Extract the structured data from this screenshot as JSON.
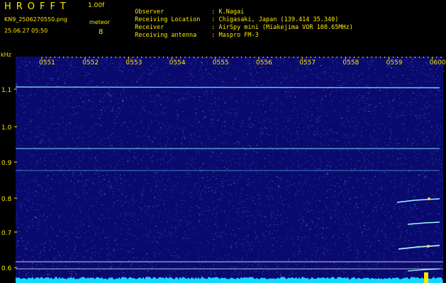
{
  "header": {
    "brand": "HROFFT",
    "version": "1.00f",
    "filename": "KN9_2506270550.png",
    "meteor_label": "meteor",
    "meteor_count": "8",
    "timestamp": "25.06.27 05:50"
  },
  "info": [
    {
      "key": "Observer",
      "value": ": K.Nagai"
    },
    {
      "key": "Receiving Location",
      "value": ": Chigasaki, Japan (139.414 35.340)"
    },
    {
      "key": "Receiver",
      "value": ": AirSpy mini (Miakejima VOR 108.65MHz)"
    },
    {
      "key": "Receiving antenna",
      "value": ": Maspro FM-3"
    }
  ],
  "axis": {
    "unit": "kHz",
    "time_labels": [
      "0551",
      "0552",
      "0553",
      "0554",
      "0555",
      "0556",
      "0557",
      "0558",
      "0559",
      "0600"
    ],
    "freq_labels": [
      "1.1",
      "1.0",
      "0.9",
      "0.8",
      "0.7",
      "0.6"
    ]
  },
  "colors": {
    "background": "#0a0a6e",
    "noise": "#3b6cff",
    "label": "#ffe600",
    "signal": "#7df0ff",
    "floor": "#14d7ff"
  }
}
